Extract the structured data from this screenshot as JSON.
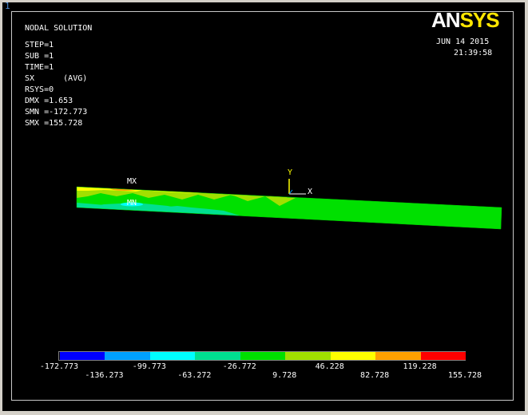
{
  "window_number": "1",
  "brand_logo": {
    "text_a": "AN",
    "text_b": "SYS"
  },
  "date": "JUN 14 2015",
  "time": "21:39:58",
  "info": {
    "title": "NODAL SOLUTION",
    "step": "STEP=1",
    "sub": "SUB =1",
    "time_line": "TIME=1",
    "component": "SX      (AVG)",
    "rsys": "RSYS=0",
    "dmx": "DMX =1.653",
    "smn": "SMN =-172.773",
    "smx": "SMX =155.728"
  },
  "labels": {
    "mx": "MX",
    "mn": "MN",
    "axis_x": "X",
    "axis_y": "Y"
  },
  "legend": {
    "colors": [
      "#0000ff",
      "#00a0ff",
      "#00ffff",
      "#00e090",
      "#00e000",
      "#a0e000",
      "#ffff00",
      "#ffa000",
      "#ff0000"
    ],
    "top_ticks": [
      "-172.773",
      "-99.773",
      "-26.772",
      "46.228",
      "119.228"
    ],
    "bottom_ticks": [
      "-136.273",
      "-63.272",
      "9.728",
      "82.728",
      "155.728"
    ]
  }
}
